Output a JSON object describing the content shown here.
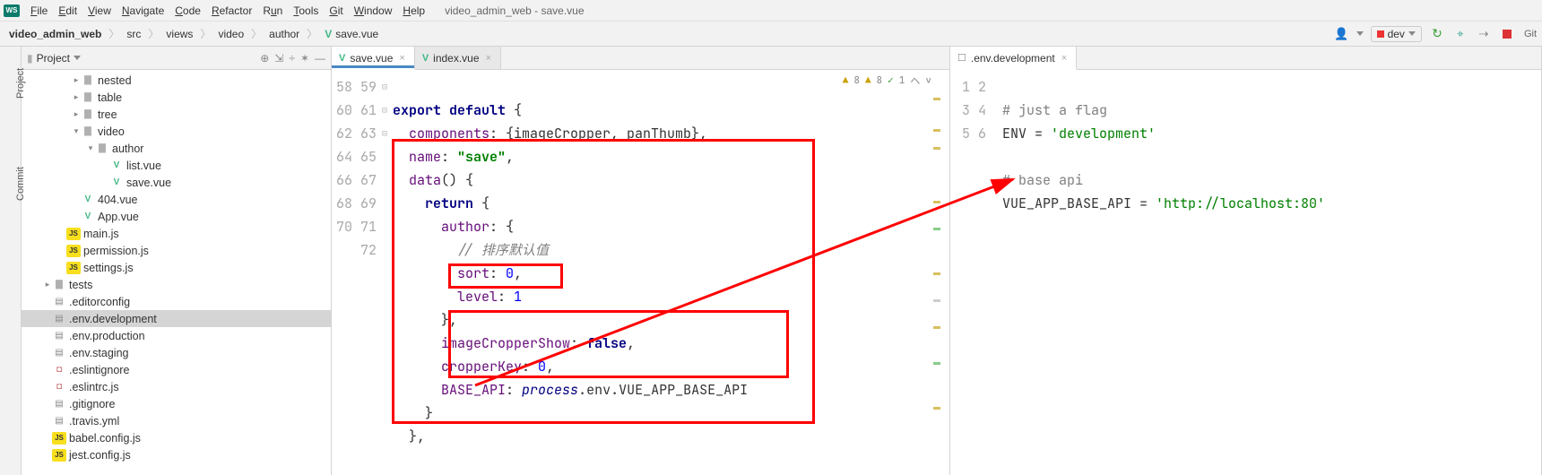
{
  "window_title": "video_admin_web - save.vue",
  "menu": [
    "File",
    "Edit",
    "View",
    "Navigate",
    "Code",
    "Refactor",
    "Run",
    "Tools",
    "Git",
    "Window",
    "Help"
  ],
  "breadcrumbs": [
    "video_admin_web",
    "src",
    "views",
    "video",
    "author",
    "save.vue"
  ],
  "run_config": "dev",
  "project_label": "Project",
  "left_gutter": {
    "project": "Project",
    "commit": "Commit"
  },
  "tree": [
    {
      "d": 3,
      "arrow": ">",
      "ico": "folder",
      "label": "nested"
    },
    {
      "d": 3,
      "arrow": ">",
      "ico": "folder",
      "label": "table"
    },
    {
      "d": 3,
      "arrow": ">",
      "ico": "folder",
      "label": "tree"
    },
    {
      "d": 3,
      "arrow": "v",
      "ico": "folder",
      "label": "video"
    },
    {
      "d": 4,
      "arrow": "v",
      "ico": "folder",
      "label": "author"
    },
    {
      "d": 5,
      "arrow": " ",
      "ico": "vue",
      "label": "list.vue"
    },
    {
      "d": 5,
      "arrow": " ",
      "ico": "vue",
      "label": "save.vue"
    },
    {
      "d": 3,
      "arrow": " ",
      "ico": "vue",
      "label": "404.vue"
    },
    {
      "d": 3,
      "arrow": " ",
      "ico": "vue",
      "label": "App.vue"
    },
    {
      "d": 2,
      "arrow": " ",
      "ico": "js",
      "label": "main.js"
    },
    {
      "d": 2,
      "arrow": " ",
      "ico": "js",
      "label": "permission.js"
    },
    {
      "d": 2,
      "arrow": " ",
      "ico": "js",
      "label": "settings.js"
    },
    {
      "d": 1,
      "arrow": ">",
      "ico": "folder",
      "label": "tests"
    },
    {
      "d": 1,
      "arrow": " ",
      "ico": "cfg",
      "label": ".editorconfig"
    },
    {
      "d": 1,
      "arrow": " ",
      "ico": "cfg",
      "label": ".env.development",
      "selected": true
    },
    {
      "d": 1,
      "arrow": " ",
      "ico": "cfg",
      "label": ".env.production"
    },
    {
      "d": 1,
      "arrow": " ",
      "ico": "cfg",
      "label": ".env.staging"
    },
    {
      "d": 1,
      "arrow": " ",
      "ico": "dot",
      "label": ".eslintignore"
    },
    {
      "d": 1,
      "arrow": " ",
      "ico": "dot",
      "label": ".eslintrc.js"
    },
    {
      "d": 1,
      "arrow": " ",
      "ico": "cfg",
      "label": ".gitignore"
    },
    {
      "d": 1,
      "arrow": " ",
      "ico": "cfg",
      "label": ".travis.yml"
    },
    {
      "d": 1,
      "arrow": " ",
      "ico": "js",
      "label": "babel.config.js"
    },
    {
      "d": 1,
      "arrow": " ",
      "ico": "js",
      "label": "jest.config.js"
    }
  ],
  "left_tabs": [
    {
      "label": "save.vue",
      "active": true,
      "kind": "vue"
    },
    {
      "label": "index.vue",
      "active": false,
      "kind": "vue"
    }
  ],
  "right_tabs": [
    {
      "label": ".env.development",
      "active": true,
      "kind": "file"
    }
  ],
  "left_lines": [
    "58",
    "59",
    "60",
    "61",
    "62",
    "63",
    "64",
    "65",
    "66",
    "67",
    "68",
    "69",
    "70",
    "71",
    "72"
  ],
  "right_lines": [
    "1",
    "2",
    "3",
    "4",
    "5",
    "6"
  ],
  "code_left": {
    "l58": {
      "kw1": "export",
      "kw2": "default"
    },
    "l59": {
      "p": "components",
      "a": "{imageCropper, panThumb},"
    },
    "l60": {
      "p": "name",
      "s": "\"save\""
    },
    "l61": {
      "p": "data"
    },
    "l62": {
      "kw": "return"
    },
    "l63": {
      "p": "author"
    },
    "l64": {
      "c": "// 排序默认值"
    },
    "l65": {
      "p": "sort",
      "n": "0"
    },
    "l66": {
      "p": "level",
      "n": "1"
    },
    "l68": {
      "p": "imageCropperShow",
      "b": "false"
    },
    "l69": {
      "p": "cropperKey",
      "n": "0"
    },
    "l70": {
      "p": "BASE_API",
      "lit": "process",
      "rest": ".env.VUE_APP_BASE_API"
    }
  },
  "code_right": {
    "l1": "# just a flag",
    "l2a": "ENV = ",
    "l2b": "'development'",
    "l4": "# base api",
    "l5a": "VUE_APP_BASE_API = ",
    "l5b": "'http://localhost:80'"
  },
  "inspections": {
    "warn": "8",
    "warn2": "8",
    "ok": "1"
  },
  "git_label": "Git"
}
